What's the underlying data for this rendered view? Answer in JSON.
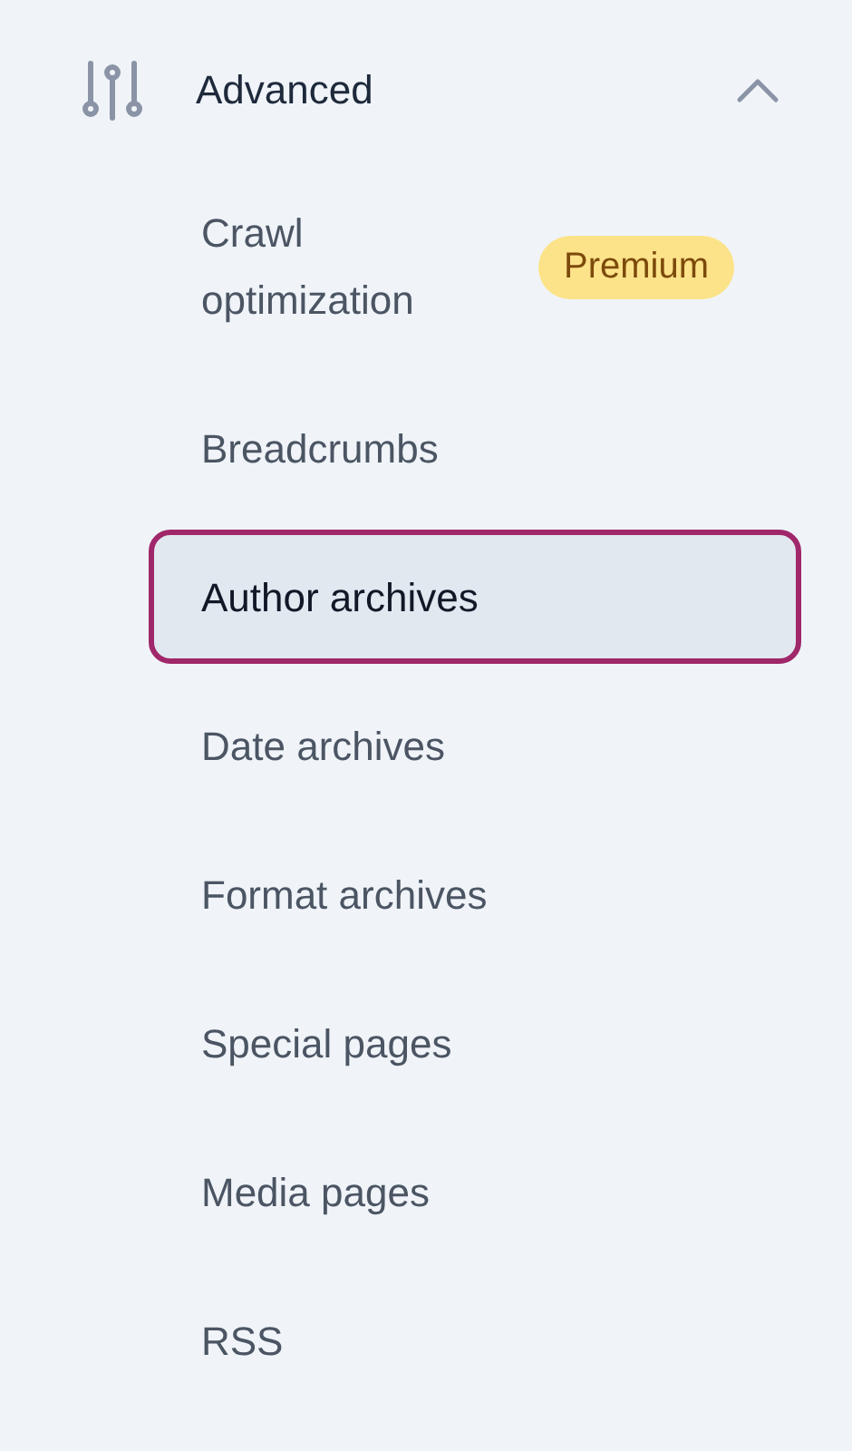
{
  "section": {
    "title": "Advanced",
    "expanded": true
  },
  "items": [
    {
      "label": "Crawl optimization",
      "selected": false,
      "badge": "Premium"
    },
    {
      "label": "Breadcrumbs",
      "selected": false
    },
    {
      "label": "Author archives",
      "selected": true
    },
    {
      "label": "Date archives",
      "selected": false
    },
    {
      "label": "Format archives",
      "selected": false
    },
    {
      "label": "Special pages",
      "selected": false
    },
    {
      "label": "Media pages",
      "selected": false
    },
    {
      "label": "RSS",
      "selected": false
    }
  ]
}
